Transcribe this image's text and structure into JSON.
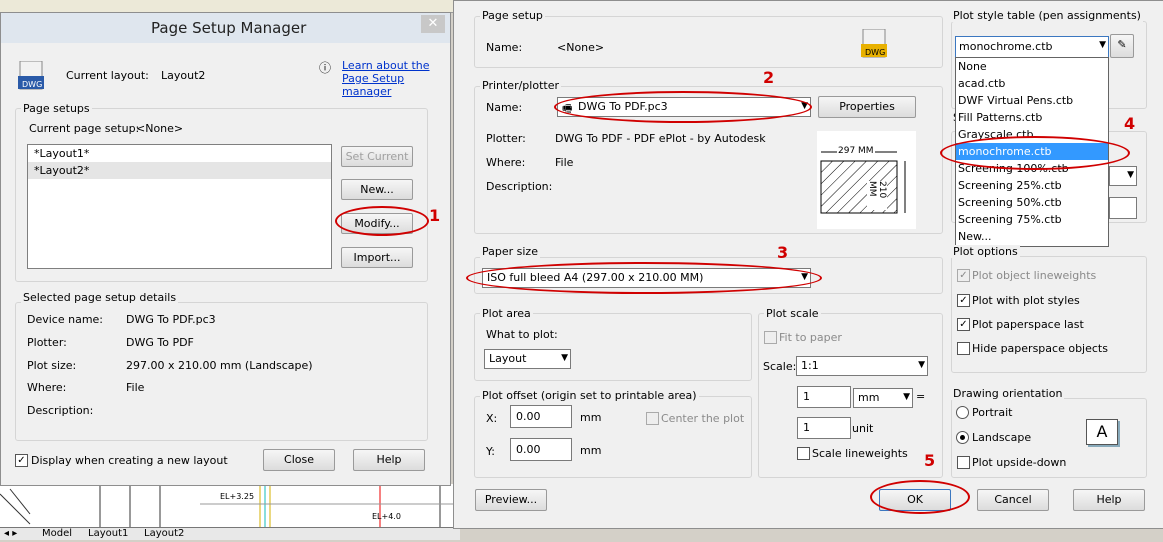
{
  "psm": {
    "title": "Page Setup Manager",
    "close_x": "✕",
    "current_layout_label": "Current layout:",
    "current_layout_value": "Layout2",
    "learn_link_line1": "Learn about the",
    "learn_link_line2": "Page Setup manager",
    "page_setups_label": "Page setups",
    "current_setup_label": "Current page setup:",
    "current_setup_value": "<None>",
    "items": [
      "*Layout1*",
      "*Layout2*"
    ],
    "set_current": "Set Current",
    "new": "New...",
    "modify": "Modify...",
    "import": "Import...",
    "details_label": "Selected page setup details",
    "details": [
      {
        "label": "Device name:",
        "value": "DWG To PDF.pc3"
      },
      {
        "label": "Plotter:",
        "value": "DWG To PDF"
      },
      {
        "label": "Plot size:",
        "value": "297.00 x 210.00 mm (Landscape)"
      },
      {
        "label": "Where:",
        "value": "File"
      },
      {
        "label": "Description:",
        "value": ""
      }
    ],
    "display_new_layout": "Display when creating a new layout",
    "close_btn": "Close",
    "help_btn": "Help"
  },
  "ps": {
    "page_setup_label": "Page setup",
    "name_label": "Name:",
    "name_value": "<None>",
    "printer_label": "Printer/plotter",
    "printer_name_label": "Name:",
    "printer_value": "DWG To PDF.pc3",
    "properties": "Properties",
    "plotter_label": "Plotter:",
    "plotter_value": "DWG To PDF - PDF ePlot - by Autodesk",
    "where_label": "Where:",
    "where_value": "File",
    "desc_label": "Description:",
    "preview_w": "297 MM",
    "preview_h": "210 MM",
    "paper_size_label": "Paper size",
    "paper_value": "ISO full bleed A4 (297.00 x 210.00 MM)",
    "plot_area_label": "Plot area",
    "what_to_plot_label": "What to plot:",
    "what_to_plot_value": "Layout",
    "plot_offset_label": "Plot offset (origin set to printable area)",
    "x_label": "X:",
    "x_value": "0.00",
    "x_unit": "mm",
    "y_label": "Y:",
    "y_value": "0.00",
    "y_unit": "mm",
    "center_plot": "Center the plot",
    "plot_scale_label": "Plot scale",
    "fit_to_paper": "Fit to paper",
    "scale_label": "Scale:",
    "scale_value": "1:1",
    "scale_num": "1",
    "scale_unit_combo": "mm",
    "eq": "=",
    "scale_den": "1",
    "scale_unit": "unit",
    "scale_lineweights": "Scale lineweights",
    "preview_btn": "Preview...",
    "ok": "OK",
    "cancel": "Cancel",
    "help": "Help",
    "pst_label": "Plot style table (pen assignments)",
    "pst_value": "monochrome.ctb",
    "pst_options": [
      "None",
      "acad.ctb",
      "DWF Virtual Pens.ctb",
      "Fill Patterns.ctb",
      "Grayscale.ctb",
      "monochrome.ctb",
      "Screening 100%.ctb",
      "Screening 25%.ctb",
      "Screening 50%.ctb",
      "Screening 75%.ctb",
      "New..."
    ],
    "sh_peek": "S",
    "plot_options_label": "Plot options",
    "opt_lineweights": "Plot object lineweights",
    "opt_styles": "Plot with plot styles",
    "opt_paperspace_last": "Plot paperspace last",
    "opt_hide": "Hide paperspace objects",
    "orientation_label": "Drawing orientation",
    "portrait": "Portrait",
    "landscape": "Landscape",
    "upside_down": "Plot upside-down",
    "orient_icon_letter": "A"
  },
  "annotations": [
    "1",
    "2",
    "3",
    "4",
    "5"
  ],
  "tabs": {
    "model": "Model",
    "layout1": "Layout1",
    "layout2": "Layout2"
  },
  "cad_texts": [
    "EL+3.25",
    "EL+4.0"
  ],
  "dwg_icon_text": "DWG"
}
